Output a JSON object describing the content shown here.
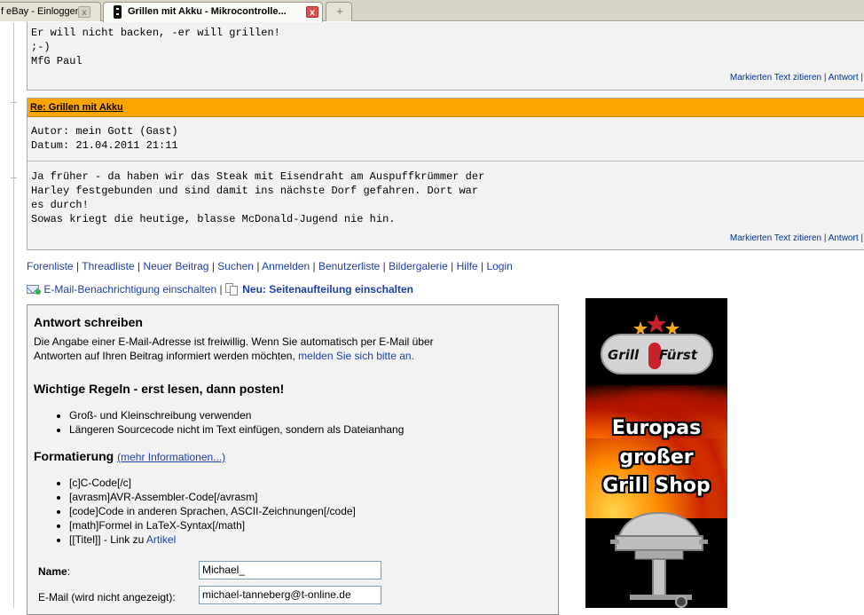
{
  "browser": {
    "tabs": [
      {
        "title": "f eBay - Einloggen",
        "active": false
      },
      {
        "title": "Grillen mit Akku - Mikrocontrolle...",
        "active": true
      }
    ],
    "close_symbol": "x",
    "new_tab_symbol": "+"
  },
  "post1": {
    "lines": [
      "Er will nicht backen, -er will grillen!",
      ";-)",
      "MfG Paul"
    ],
    "quote_label": "Markierten Text zitieren",
    "reply_label": "Antwort"
  },
  "post2": {
    "subject": "Re: Grillen mit Akku",
    "author": "Autor: mein Gott (Gast)",
    "date": "Datum: 21.04.2011 21:11",
    "lines": [
      "Ja früher - da haben wir das Steak mit Eisendraht am Auspuffkrümmer der",
      "Harley festgebunden und sind damit ins nächste Dorf gefahren. Dort war",
      "es durch!",
      "Sowas kriegt die heutige, blasse McDonald-Jugend nie hin."
    ],
    "quote_label": "Markierten Text zitieren",
    "reply_label": "Antwort"
  },
  "nav": {
    "links": [
      "Forenliste",
      "Threadliste",
      "Neuer Beitrag",
      "Suchen",
      "Anmelden",
      "Benutzerliste",
      "Bildergalerie",
      "Hilfe",
      "Login"
    ]
  },
  "notify": {
    "email_label": "E-Mail-Benachrichtigung einschalten",
    "paging_label": "Neu: Seitenaufteilung einschalten"
  },
  "reply_form": {
    "title": "Antwort schreiben",
    "intro_text": "Die Angabe einer E-Mail-Adresse ist freiwillig. Wenn Sie automatisch per E-Mail über Antworten auf Ihren Beitrag informiert werden möchten,",
    "intro_link": "melden Sie sich bitte an.",
    "rules_heading": "Wichtige Regeln - erst lesen, dann posten!",
    "rules": [
      "Groß- und Kleinschreibung verwenden",
      "Längeren Sourcecode nicht im Text einfügen, sondern als Dateianhang"
    ],
    "format_heading": "Formatierung",
    "format_more": "(mehr Informationen...)",
    "formats": [
      "[c]C-Code[/c]",
      "[avrasm]AVR-Assembler-Code[/avrasm]",
      "[code]Code in anderen Sprachen, ASCII-Zeichnungen[/code]",
      "[math]Formel in LaTeX-Syntax[/math]"
    ],
    "format_last_prefix": "[[Titel]] - Link zu",
    "format_last_link": "Artikel",
    "name_label": "Name",
    "name_label_suffix": ":",
    "name_value": "Michael_",
    "email_label": "E-Mail (wird nicht angezeigt):",
    "email_value": "michael-tanneberg@t-online.de"
  },
  "ad": {
    "brand_left": "Grill",
    "brand_right": "Fürst",
    "line1": "Europas",
    "line2": "großer",
    "line3": "Grill Shop",
    "colors": {
      "flame": "#ff7a00",
      "star": "#f5a623",
      "brand_red": "#c8202c"
    }
  },
  "colors": {
    "post_header": "#ffa500",
    "link": "#1e3fa8",
    "post_bg": "#f2f2f2"
  }
}
